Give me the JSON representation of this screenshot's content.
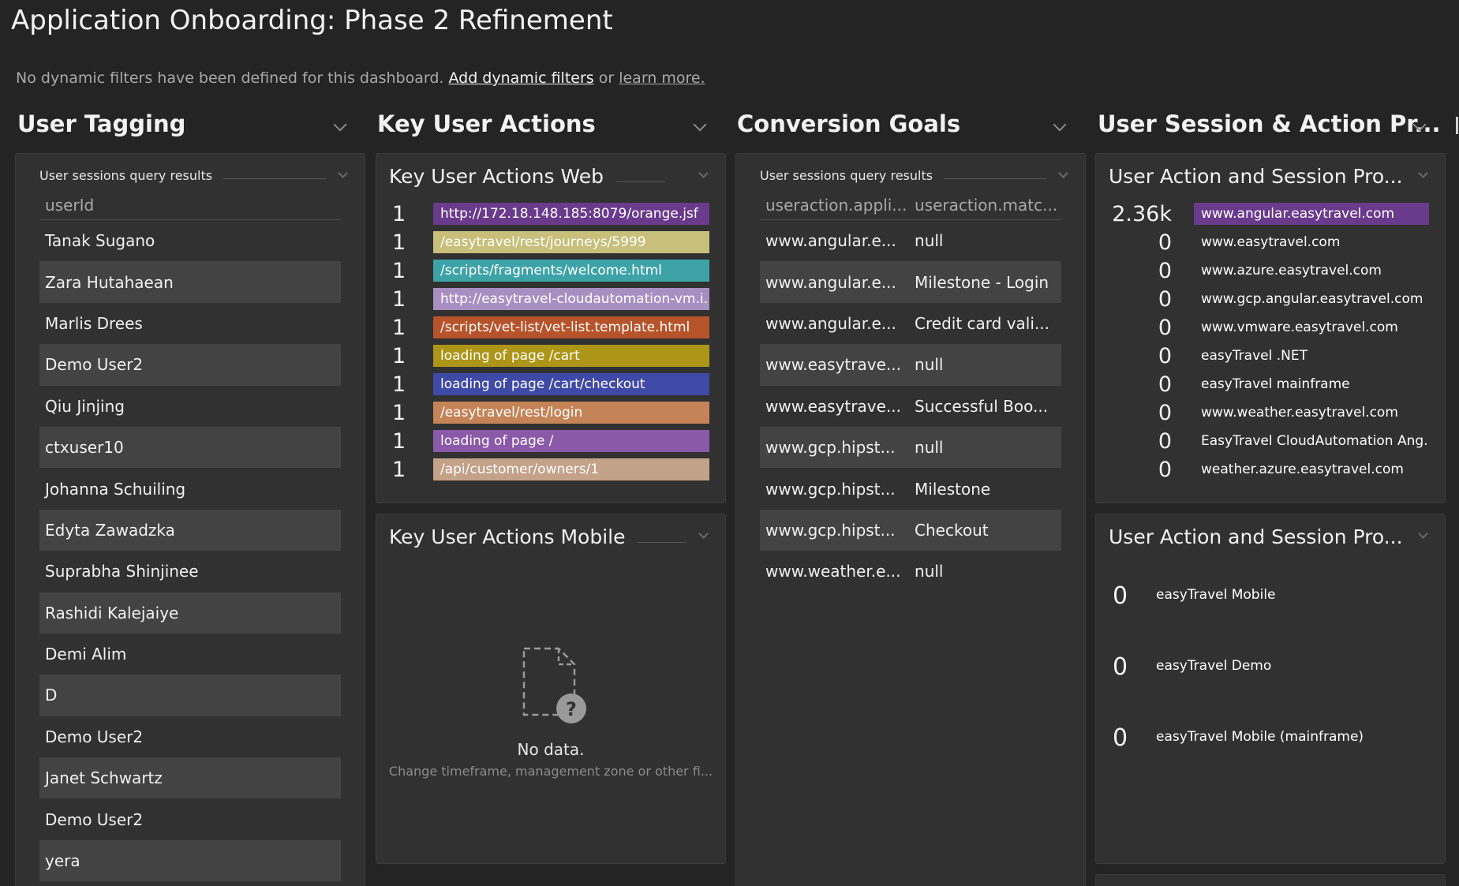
{
  "page": {
    "title": "Application Onboarding: Phase 2 Refinement"
  },
  "filters": {
    "text": "No dynamic filters have been defined for this dashboard.",
    "add_link": "Add dynamic filters",
    "or": "or",
    "learn_link": "learn more."
  },
  "sections": {
    "user_tagging": "User Tagging",
    "key_user_actions": "Key User Actions",
    "conversion_goals": "Conversion Goals",
    "session_props": "User Session & Action Pr..."
  },
  "user_tagging_tile": {
    "title": "User sessions query results",
    "column": "userId",
    "rows": [
      "Tanak Sugano",
      "Zara Hutahaean",
      "Marlis Drees",
      "Demo User2",
      "Qiu Jinjing",
      "ctxuser10",
      "Johanna Schuiling",
      "Edyta Zawadzka",
      "Suprabha Shinjinee",
      "Rashidi Kalejaiye",
      "Demi Alim",
      "D",
      "Demo User2",
      "Janet Schwartz",
      "Demo User2",
      "yera"
    ]
  },
  "kua_web": {
    "title": "Key User Actions Web",
    "items": [
      {
        "count": "1",
        "label": "http://172.18.148.185:8079/orange.jsf",
        "color": "#6a3a8c"
      },
      {
        "count": "1",
        "label": "/easytravel/rest/journeys/5999",
        "color": "#c7bf7a"
      },
      {
        "count": "1",
        "label": "/scripts/fragments/welcome.html",
        "color": "#3ea3a6"
      },
      {
        "count": "1",
        "label": "http://easytravel-cloudautomation-vm.i...",
        "color": "#a88fc2"
      },
      {
        "count": "1",
        "label": "/scripts/vet-list/vet-list.template.html",
        "color": "#b7532b"
      },
      {
        "count": "1",
        "label": "loading of page /cart",
        "color": "#ad9518"
      },
      {
        "count": "1",
        "label": "loading of page /cart/checkout",
        "color": "#3f4aa6"
      },
      {
        "count": "1",
        "label": "/easytravel/rest/login",
        "color": "#c48458"
      },
      {
        "count": "1",
        "label": "loading of page /",
        "color": "#8a5aa8"
      },
      {
        "count": "1",
        "label": "/api/customer/owners/1",
        "color": "#c3a28a"
      }
    ]
  },
  "kua_mobile": {
    "title": "Key User Actions Mobile",
    "nodata_title": "No data.",
    "nodata_sub": "Change timeframe, management zone or other fi..."
  },
  "conversion_tile": {
    "title": "User sessions query results",
    "columns": [
      "useraction.appli...",
      "useraction.matc..."
    ],
    "rows": [
      [
        "www.angular.e...",
        "null"
      ],
      [
        "www.angular.e...",
        "Milestone - Login"
      ],
      [
        "www.angular.e...",
        "Credit card vali..."
      ],
      [
        "www.easytrave...",
        "null"
      ],
      [
        "www.easytrave...",
        "Successful Boo..."
      ],
      [
        "www.gcp.hipst...",
        "null"
      ],
      [
        "www.gcp.hipst...",
        "Milestone"
      ],
      [
        "www.gcp.hipst...",
        "Checkout"
      ],
      [
        "www.weather.e...",
        "null"
      ]
    ]
  },
  "props_web": {
    "title": "User Action and Session Pro...",
    "highlight_color": "#6a3a8c",
    "items": [
      {
        "count": "2.36k",
        "label": "www.angular.easytravel.com",
        "highlight": true
      },
      {
        "count": "0",
        "label": "www.easytravel.com"
      },
      {
        "count": "0",
        "label": "www.azure.easytravel.com"
      },
      {
        "count": "0",
        "label": "www.gcp.angular.easytravel.com"
      },
      {
        "count": "0",
        "label": "www.vmware.easytravel.com"
      },
      {
        "count": "0",
        "label": "easyTravel .NET"
      },
      {
        "count": "0",
        "label": "easyTravel mainframe"
      },
      {
        "count": "0",
        "label": "www.weather.easytravel.com"
      },
      {
        "count": "0",
        "label": "EasyTravel CloudAutomation Ang..."
      },
      {
        "count": "0",
        "label": "weather.azure.easytravel.com"
      }
    ]
  },
  "props_mobile": {
    "title": "User Action and Session Pro...",
    "items": [
      {
        "count": "0",
        "label": "easyTravel Mobile"
      },
      {
        "count": "0",
        "label": "easyTravel Demo"
      },
      {
        "count": "0",
        "label": "easyTravel Mobile (mainframe)"
      }
    ]
  }
}
